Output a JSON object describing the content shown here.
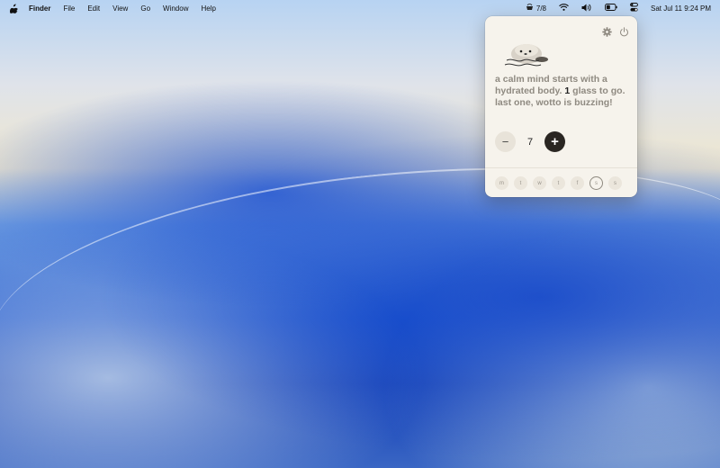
{
  "menubar": {
    "app_name": "Finder",
    "menus": [
      "File",
      "Edit",
      "View",
      "Go",
      "Window",
      "Help"
    ],
    "water_status": "7/8",
    "datetime": "Sat Jul 11  9:24 PM"
  },
  "panel": {
    "message_before": "a calm mind starts with a hydrated body. ",
    "message_count": "1",
    "message_after": " glass to go. last one, wotto is buzzing!",
    "minus_label": "−",
    "plus_label": "+",
    "count": "7",
    "days": [
      "m",
      "t",
      "w",
      "t",
      "f",
      "s",
      "s"
    ],
    "today_index": 5
  },
  "icons": {
    "apple": "apple-icon",
    "cup": "cup-icon",
    "wifi": "wifi-icon",
    "volume": "volume-icon",
    "battery": "battery-icon",
    "control_center": "control-center-icon",
    "gear": "gear-icon",
    "power": "power-icon",
    "mascot": "otter-mascot"
  }
}
